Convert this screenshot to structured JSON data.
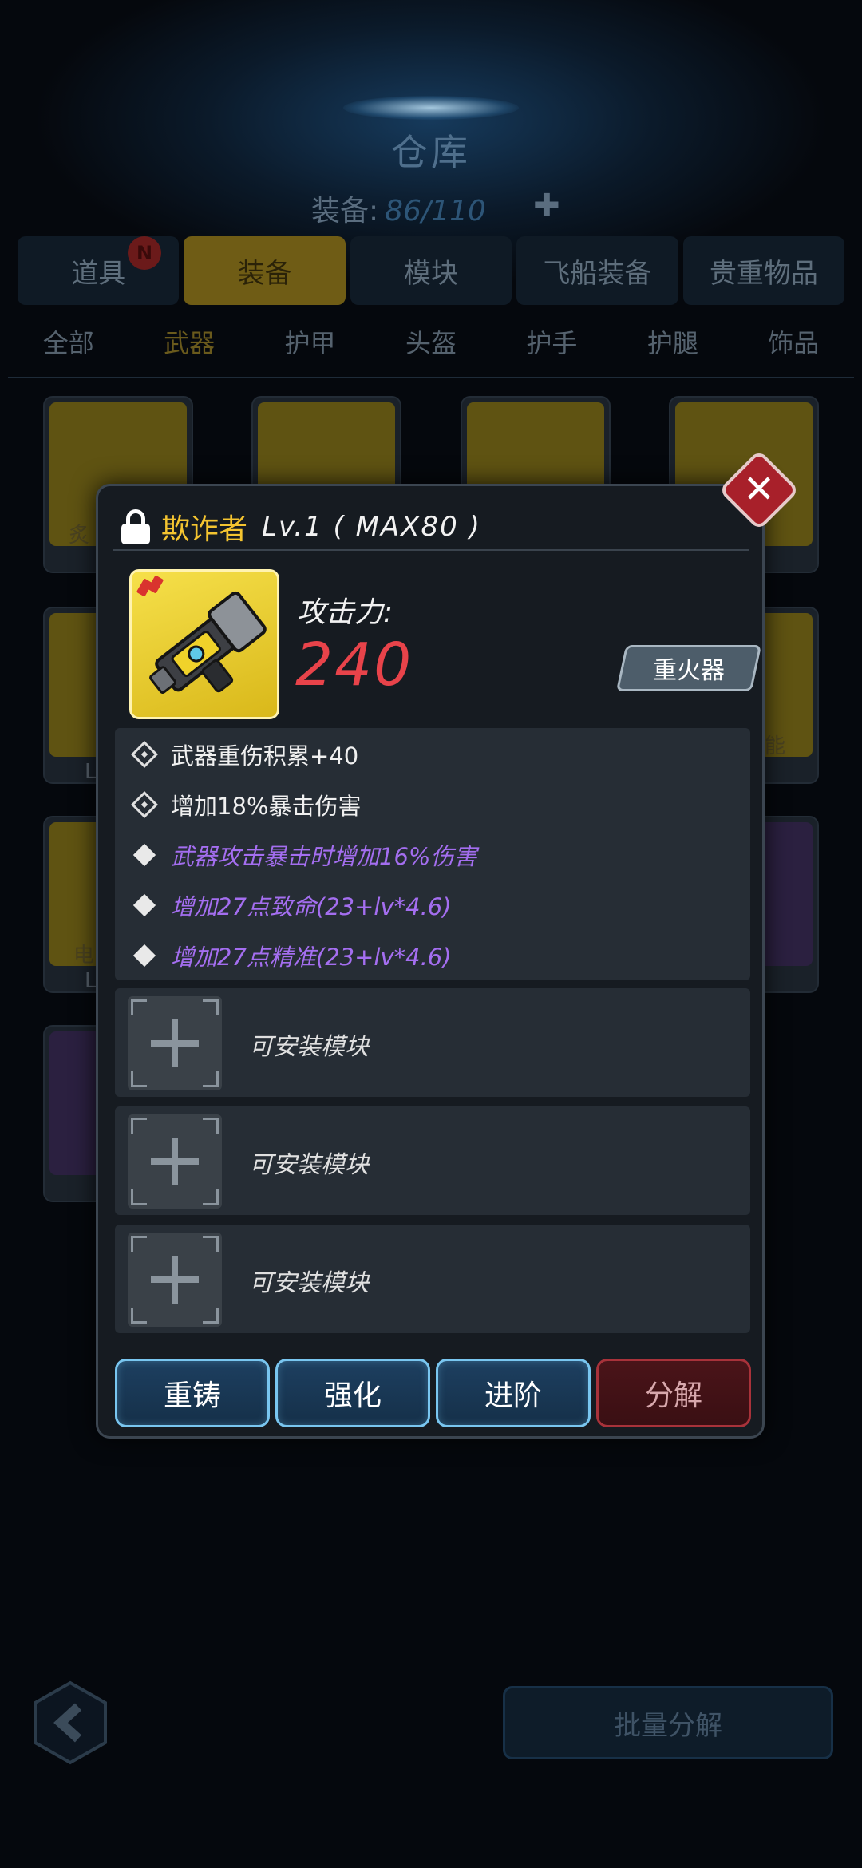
{
  "header": {
    "title": "仓库",
    "equip_label": "装备:",
    "equip_count": "86/110"
  },
  "main_tabs": [
    {
      "label": "道具",
      "badge": "N"
    },
    {
      "label": "装备"
    },
    {
      "label": "模块"
    },
    {
      "label": "飞船装备"
    },
    {
      "label": "贵重物品"
    }
  ],
  "sub_tabs": [
    "全部",
    "武器",
    "护甲",
    "头盔",
    "护手",
    "护腿",
    "饰品"
  ],
  "grid_labels": [
    "炙",
    "L",
    "能",
    "电",
    "L"
  ],
  "bottom": {
    "bulk_label": "批量分解"
  },
  "dialog": {
    "name": "欺诈者",
    "level": "Lv.1 ( MAX80 )",
    "attack_label": "攻击力:",
    "attack_value": "240",
    "type": "重火器",
    "attributes": [
      {
        "icon": "target-icon",
        "text": "武器重伤积累+40",
        "color": "white"
      },
      {
        "icon": "target-icon",
        "text": "增加18%暴击伤害",
        "color": "white"
      },
      {
        "icon": "diamond-icon",
        "text": "武器攻击暴击时增加16%伤害",
        "color": "purple"
      },
      {
        "icon": "diamond-icon",
        "text": "增加27点致命(23+lv*4.6)",
        "color": "purple"
      },
      {
        "icon": "diamond-icon",
        "text": "增加27点精准(23+lv*4.6)",
        "color": "purple"
      }
    ],
    "slots": [
      "可安装模块",
      "可安装模块",
      "可安装模块"
    ],
    "buttons": {
      "recast": "重铸",
      "enhance": "强化",
      "advance": "进阶",
      "dismantle": "分解"
    },
    "colors": {
      "name": "#f4c430",
      "attack": "#e8434a",
      "purple_attr": "#a46ef0"
    }
  }
}
